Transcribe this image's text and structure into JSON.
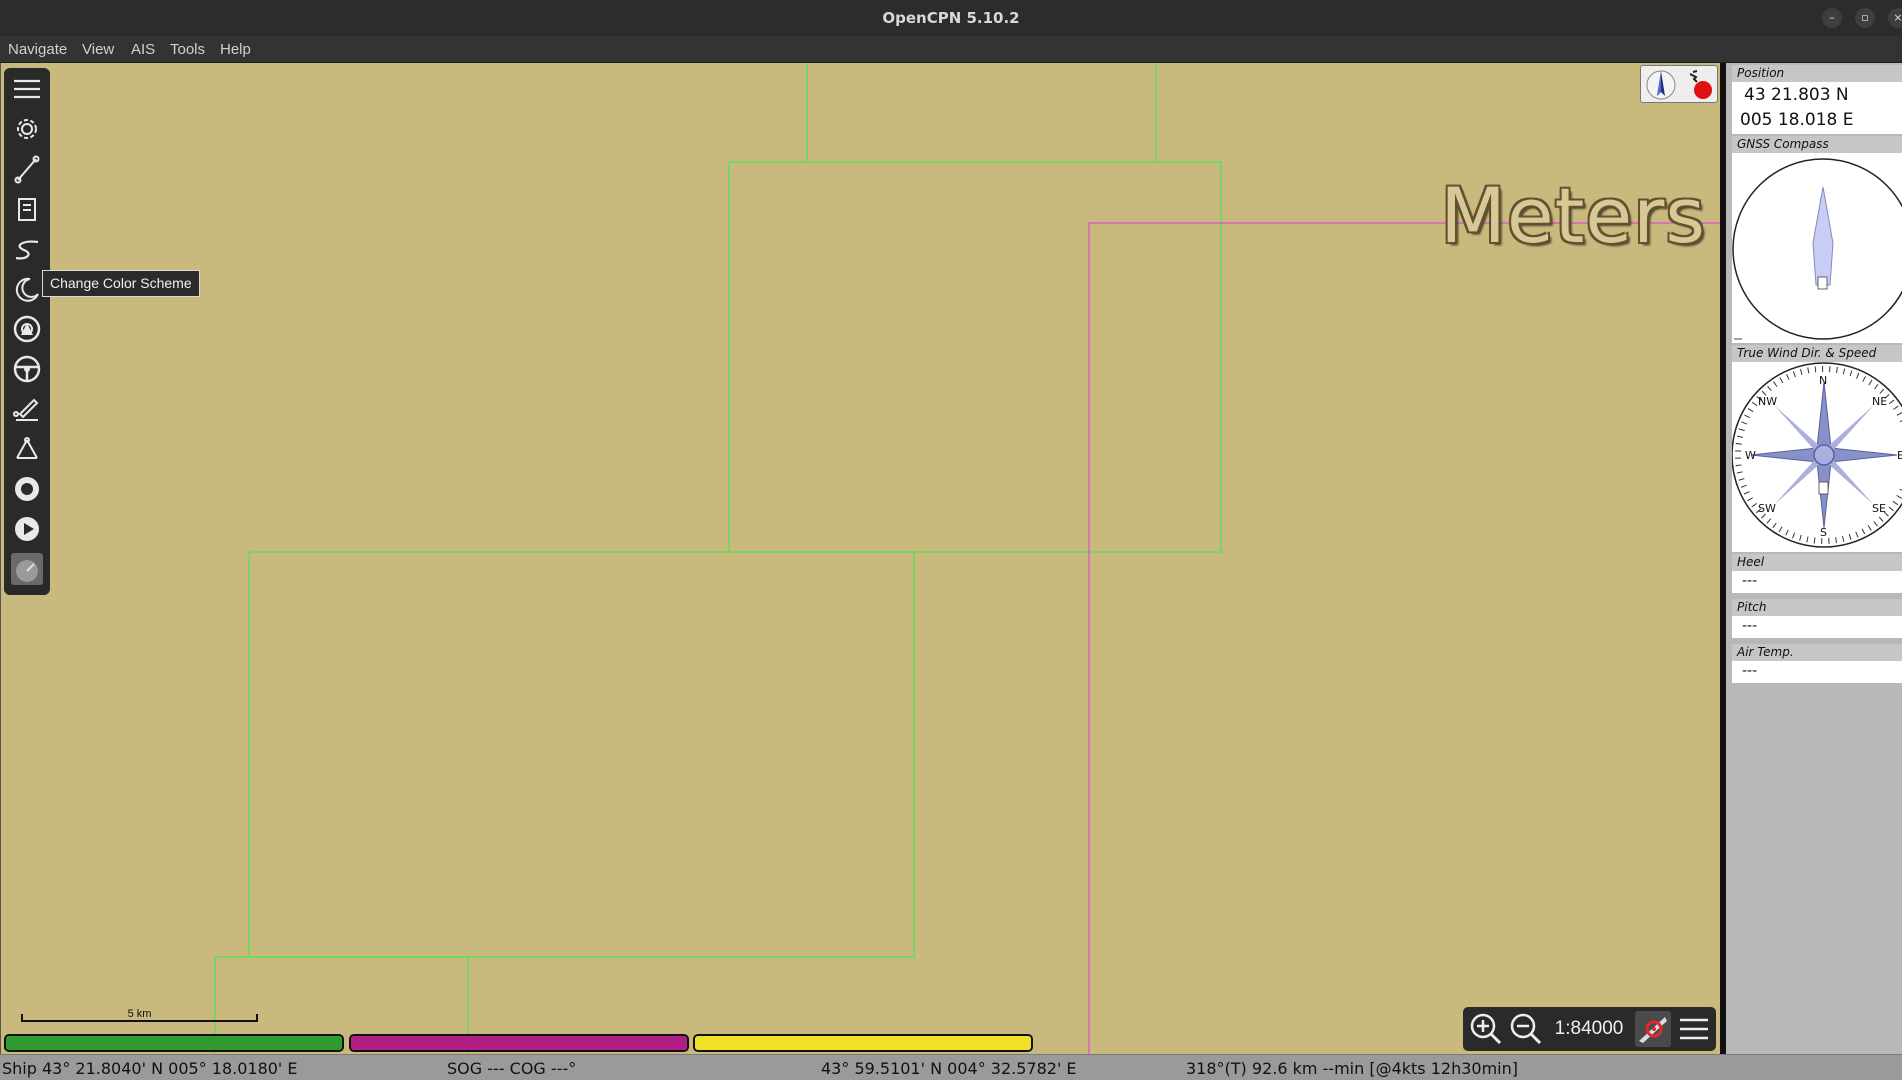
{
  "window": {
    "title": "OpenCPN 5.10.2",
    "buttons": {
      "minimize": "–",
      "maximize": "▫",
      "close": "×"
    }
  },
  "menu": {
    "items": [
      {
        "label": "Navigate"
      },
      {
        "label": "View"
      },
      {
        "label": "AIS"
      },
      {
        "label": "Tools"
      },
      {
        "label": "Help"
      }
    ]
  },
  "toolbar": {
    "tooltip": "Change Color Scheme",
    "tools": [
      {
        "name": "menu-icon"
      },
      {
        "name": "gear-icon"
      },
      {
        "name": "route-icon"
      },
      {
        "name": "document-icon"
      },
      {
        "name": "track-icon"
      },
      {
        "name": "moon-icon"
      },
      {
        "name": "center-ship-icon"
      },
      {
        "name": "steering-wheel-icon"
      },
      {
        "name": "edit-route-icon"
      },
      {
        "name": "waypoint-icon"
      },
      {
        "name": "record-icon"
      },
      {
        "name": "play-icon"
      },
      {
        "name": "dashboard-icon"
      }
    ]
  },
  "chart": {
    "depth_units": "Meters",
    "scale_label": "5 km",
    "colors": {
      "land": "#c9b97c",
      "quilt_outline": "#5ce05a",
      "coverage_outline": "#d94fd3"
    }
  },
  "piano": {
    "keys": [
      {
        "color": "#2f9a2f"
      },
      {
        "color": "#b01e86"
      },
      {
        "color": "#f0e126"
      }
    ]
  },
  "zoom": {
    "scale": "1:84000"
  },
  "dashboard": {
    "position": {
      "title": "Position",
      "lat": "43 21.803 N",
      "lon": "005 18.018 E"
    },
    "gnss_compass": {
      "title": "GNSS Compass"
    },
    "wind": {
      "title": "True Wind Dir. & Speed",
      "cardinals": {
        "n": "N",
        "ne": "NE",
        "e": "E",
        "se": "SE",
        "s": "S",
        "sw": "SW",
        "w": "W",
        "nw": "NW"
      }
    },
    "heel": {
      "title": "Heel",
      "value": "---"
    },
    "pitch": {
      "title": "Pitch",
      "value": "---"
    },
    "air_temp": {
      "title": "Air Temp.",
      "value": "---"
    }
  },
  "status": {
    "ship": "Ship 43° 21.8040' N   005° 18.0180' E",
    "sog_cog": "SOG --- COG ---°",
    "cursor": "43° 59.5101' N   004° 32.5782' E",
    "bearing": "318°(T)  92.6 km --min [@4kts 12h30min]"
  }
}
